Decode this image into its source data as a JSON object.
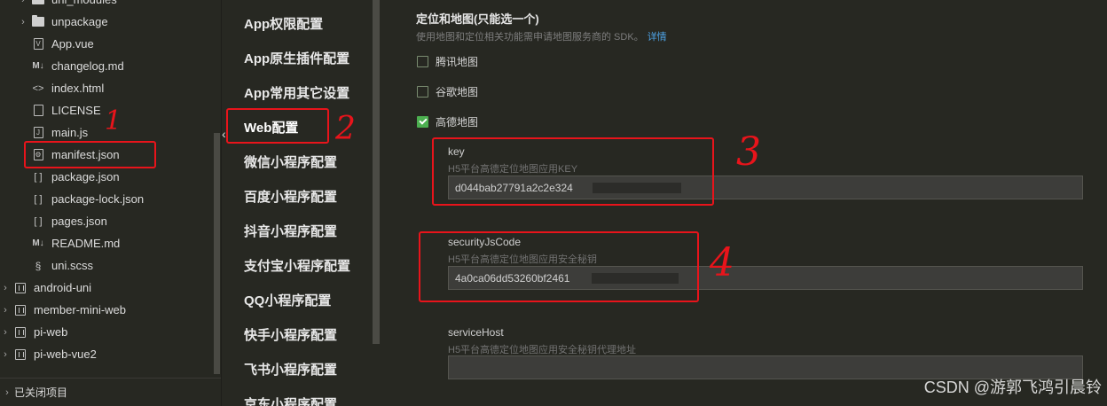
{
  "tree": {
    "items": [
      {
        "name": "uni_modules",
        "kind": "folder",
        "chev": "›"
      },
      {
        "name": "unpackage",
        "kind": "folder",
        "chev": "›"
      },
      {
        "name": "App.vue",
        "kind": "vue"
      },
      {
        "name": "changelog.md",
        "kind": "md"
      },
      {
        "name": "index.html",
        "kind": "html"
      },
      {
        "name": "LICENSE",
        "kind": "file"
      },
      {
        "name": "main.js",
        "kind": "js"
      },
      {
        "name": "manifest.json",
        "kind": "manifest"
      },
      {
        "name": "package.json",
        "kind": "json"
      },
      {
        "name": "package-lock.json",
        "kind": "json"
      },
      {
        "name": "pages.json",
        "kind": "json"
      },
      {
        "name": "README.md",
        "kind": "md"
      },
      {
        "name": "uni.scss",
        "kind": "scss"
      },
      {
        "name": "android-uni",
        "kind": "project",
        "chev": "›"
      },
      {
        "name": "member-mini-web",
        "kind": "project",
        "chev": "›"
      },
      {
        "name": "pi-web",
        "kind": "project",
        "chev": "›"
      },
      {
        "name": "pi-web-vue2",
        "kind": "project",
        "chev": "›"
      }
    ],
    "closed_projects": "已关闭项目"
  },
  "nav": {
    "items": [
      "App权限配置",
      "App原生插件配置",
      "App常用其它设置",
      "Web配置",
      "微信小程序配置",
      "百度小程序配置",
      "抖音小程序配置",
      "支付宝小程序配置",
      "QQ小程序配置",
      "快手小程序配置",
      "飞书小程序配置",
      "京东小程序配置"
    ],
    "active": "Web配置"
  },
  "section": {
    "title": "定位和地图(只能选一个)",
    "desc": "使用地图和定位相关功能需申请地图服务商的 SDK。",
    "link": "详情"
  },
  "options": [
    {
      "label": "腾讯地图",
      "checked": false
    },
    {
      "label": "谷歌地图",
      "checked": false
    },
    {
      "label": "高德地图",
      "checked": true
    }
  ],
  "fields": {
    "key": {
      "label": "key",
      "hint": "H5平台高德定位地图应用KEY",
      "value": "d044bab27791a2c2e324"
    },
    "security": {
      "label": "securityJsCode",
      "hint": "H5平台高德定位地图应用安全秘钥",
      "value": "4a0ca06dd53260bf2461"
    },
    "host": {
      "label": "serviceHost",
      "hint": "H5平台高德定位地图应用安全秘钥代理地址",
      "value": ""
    }
  },
  "annotations": [
    "1",
    "2",
    "3",
    "4"
  ],
  "watermark": "CSDN @游郭飞鸿引晨铃"
}
